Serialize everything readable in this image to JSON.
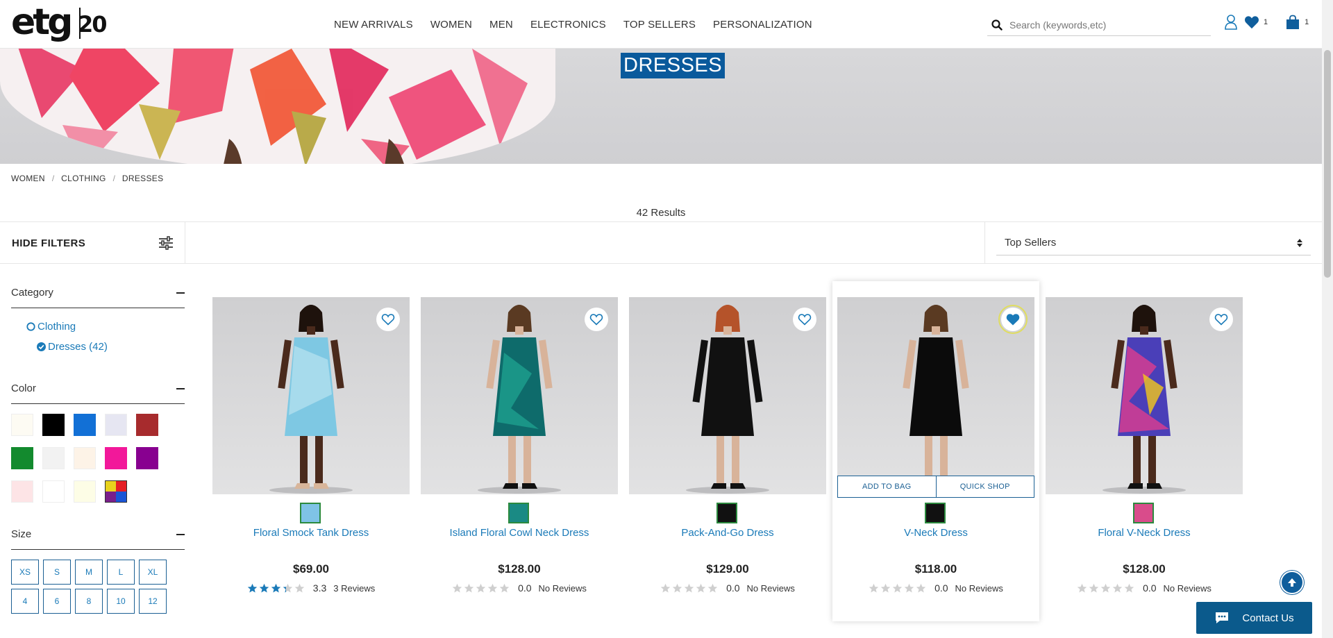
{
  "brand": {
    "logo_text": "etg",
    "logo_number": "20"
  },
  "nav": {
    "items": [
      {
        "label": "NEW ARRIVALS"
      },
      {
        "label": "WOMEN"
      },
      {
        "label": "MEN"
      },
      {
        "label": "ELECTRONICS"
      },
      {
        "label": "TOP SELLERS"
      },
      {
        "label": "PERSONALIZATION"
      }
    ]
  },
  "search": {
    "placeholder": "Search (keywords,etc)",
    "value": ""
  },
  "header_icons": {
    "wishlist_count": "1",
    "bag_count": "1"
  },
  "hero": {
    "title": "DRESSES"
  },
  "breadcrumb": [
    {
      "label": "WOMEN"
    },
    {
      "label": "CLOTHING"
    },
    {
      "label": "DRESSES"
    }
  ],
  "results": {
    "text": "42 Results"
  },
  "filters": {
    "toggle_label": "HIDE FILTERS",
    "category": {
      "title": "Category",
      "items": [
        {
          "label": "Clothing",
          "selected": false
        },
        {
          "label": "Dresses (42)",
          "selected": true
        }
      ]
    },
    "color": {
      "title": "Color",
      "swatches": [
        "#fdfbf3",
        "#000000",
        "#1270d6",
        "#e6e6f2",
        "#a72b2d",
        "#138a2e",
        "#f2f2f2",
        "#fdf3e7",
        "#f2189a",
        "#880090",
        "#fde4e6",
        "#ffffff",
        "#fdfde6",
        "multicolor"
      ]
    },
    "size": {
      "title": "Size",
      "options": [
        "XS",
        "S",
        "M",
        "L",
        "XL",
        "4",
        "6",
        "8",
        "10",
        "12"
      ]
    }
  },
  "sort": {
    "selected": "Top Sellers"
  },
  "products": [
    {
      "name": "Floral Smock Tank Dress",
      "price": "$69.00",
      "rating": 3.3,
      "score": "3.3",
      "reviews": "3 Reviews",
      "favorited": false,
      "dress_color": "#7ec8e3",
      "swatch": "#7fc3e6"
    },
    {
      "name": "Island Floral Cowl Neck Dress",
      "price": "$128.00",
      "rating": 0,
      "score": "0.0",
      "reviews": "No Reviews",
      "favorited": false,
      "dress_color": "#0e6b6b",
      "swatch": "#1a8a84"
    },
    {
      "name": "Pack-And-Go Dress",
      "price": "$129.00",
      "rating": 0,
      "score": "0.0",
      "reviews": "No Reviews",
      "favorited": false,
      "dress_color": "#111111",
      "swatch": "#111111"
    },
    {
      "name": "V-Neck Dress",
      "price": "$118.00",
      "rating": 0,
      "score": "0.0",
      "reviews": "No Reviews",
      "favorited": true,
      "dress_color": "#0b0b0b",
      "swatch": "#111111",
      "add_to_bag": "ADD TO BAG",
      "quick_shop": "QUICK SHOP"
    },
    {
      "name": "Floral V-Neck Dress",
      "price": "$128.00",
      "rating": 0,
      "score": "0.0",
      "reviews": "No Reviews",
      "favorited": false,
      "dress_color": "#4a3fb8",
      "swatch": "#d94c8b"
    }
  ],
  "contact": {
    "label": "Contact Us"
  },
  "colors": {
    "accent": "#1a7ab8",
    "dark_blue": "#0b5a8c"
  }
}
